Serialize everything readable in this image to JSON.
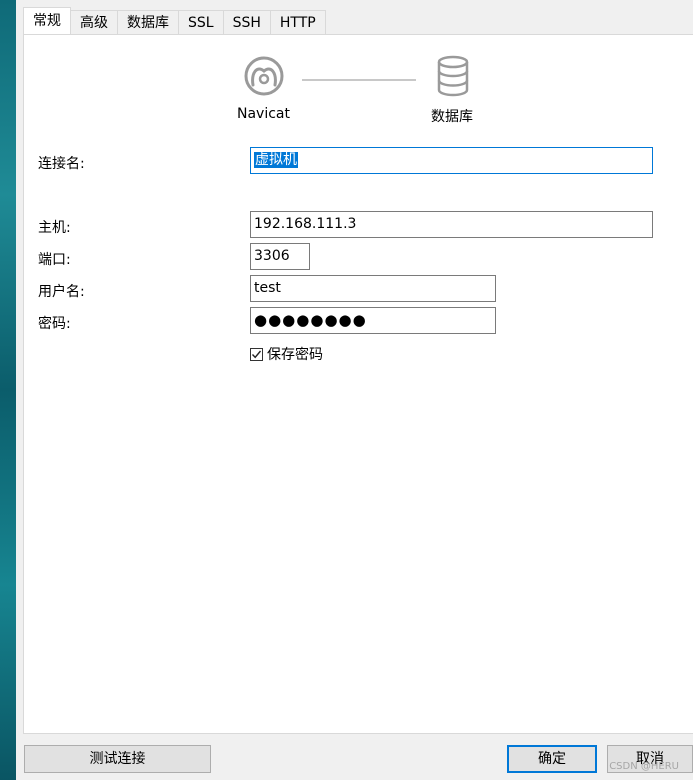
{
  "tabs": [
    {
      "label": "常规",
      "active": true
    },
    {
      "label": "高级",
      "active": false
    },
    {
      "label": "数据库",
      "active": false
    },
    {
      "label": "SSL",
      "active": false
    },
    {
      "label": "SSH",
      "active": false
    },
    {
      "label": "HTTP",
      "active": false
    }
  ],
  "diagram": {
    "left_label": "Navicat",
    "left_icon": "navicat-icon",
    "right_label": "数据库",
    "right_icon": "database-icon"
  },
  "form": {
    "connection_name_label": "连接名:",
    "connection_name_value": "虚拟机",
    "host_label": "主机:",
    "host_value": "192.168.111.3",
    "port_label": "端口:",
    "port_value": "3306",
    "user_label": "用户名:",
    "user_value": "test",
    "password_label": "密码:",
    "password_value": "●●●●●●●●",
    "save_password_label": "保存密码",
    "save_password_checked": true
  },
  "buttons": {
    "test_connection": "测试连接",
    "ok": "确定",
    "cancel": "取消"
  },
  "watermark": "CSDN @HERU",
  "colors": {
    "accent": "#0078d7",
    "panel_bg": "#ffffff",
    "window_bg": "#f0f0f0"
  }
}
